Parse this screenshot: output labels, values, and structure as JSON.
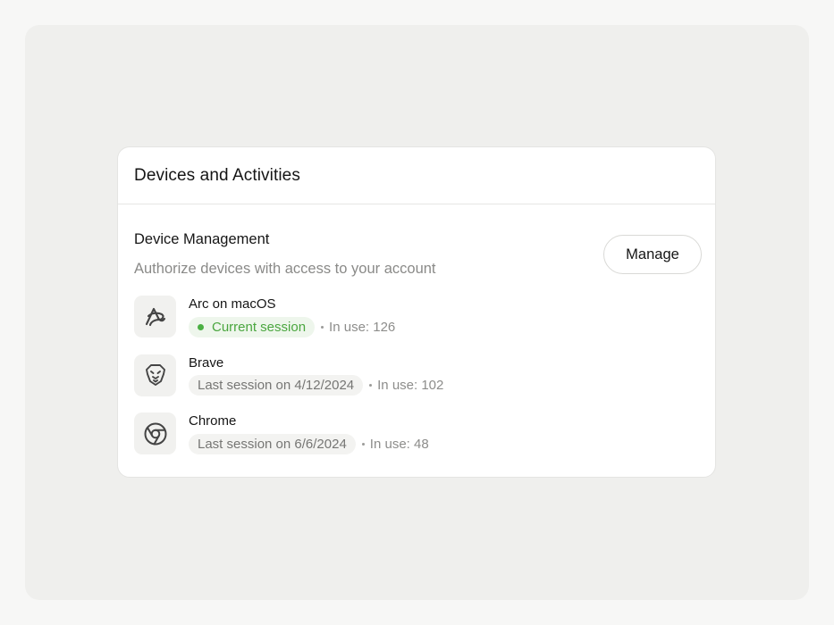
{
  "card": {
    "title": "Devices and Activities"
  },
  "section": {
    "title": "Device Management",
    "subtitle": "Authorize devices with access to your account",
    "manage_label": "Manage"
  },
  "devices": [
    {
      "name": "Arc on macOS",
      "icon": "arc-browser-icon",
      "session": "Current session",
      "current": true,
      "usage": "In use: 126"
    },
    {
      "name": "Brave",
      "icon": "brave-lion-icon",
      "session": "Last session on 4/12/2024",
      "current": false,
      "usage": "In use: 102"
    },
    {
      "name": "Chrome",
      "icon": "chrome-icon",
      "session": "Last session on 6/6/2024",
      "current": false,
      "usage": "In use: 48"
    }
  ],
  "colors": {
    "current_session_text": "#4aa63f",
    "current_session_bg": "#eef6ec",
    "current_dot": "#4bb043"
  }
}
